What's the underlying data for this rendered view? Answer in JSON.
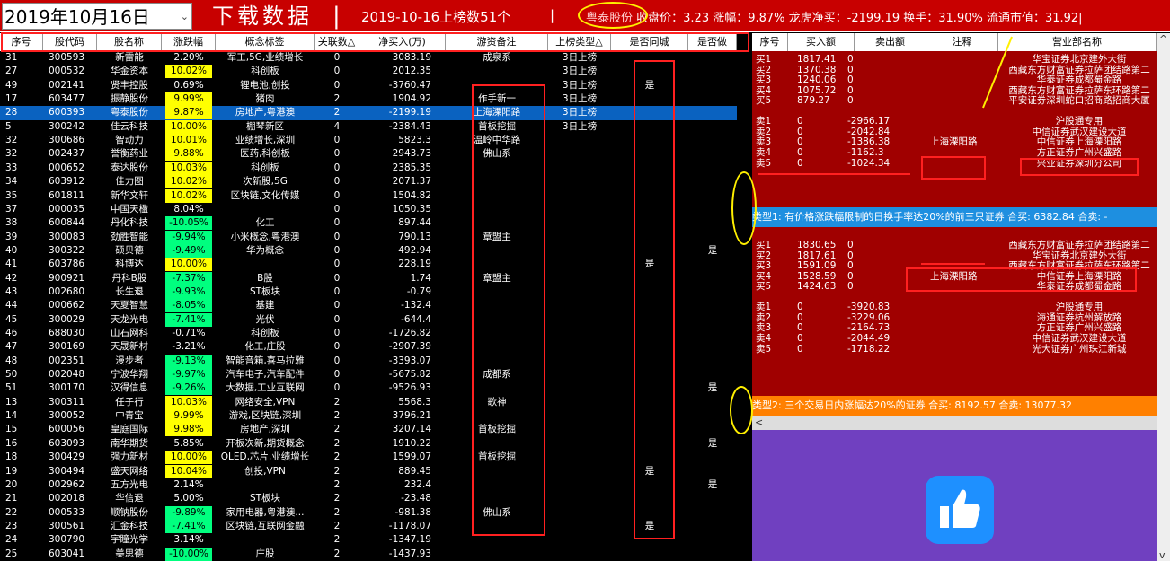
{
  "topbar": {
    "date": "2019年10月16日",
    "title": "下载数据",
    "sep": "|",
    "count": "2019-10-16上榜数51个",
    "count_sep": "|",
    "stock_name": "粤泰股份",
    "stock_detail": "收盘价：3.23 涨幅：9.87% 龙虎净买：-2199.19 换手：31.90% 流通市值：31.92|"
  },
  "left_headers": [
    "序号",
    "股代码",
    "股名称",
    "涨跌幅",
    "概念标签",
    "关联数△",
    "净买入(万)",
    "游资备注",
    "上榜类型△",
    "是否同城",
    "是否做"
  ],
  "rows": [
    [
      "31",
      "300593",
      "新雷能",
      "2.20%",
      "军工,5G,业绩增长",
      "0",
      "3083.19",
      "成泉系",
      "3日上榜",
      "",
      ""
    ],
    [
      "27",
      "000532",
      "华金资本",
      "10.02%",
      "科创板",
      "0",
      "2012.35",
      "",
      "3日上榜",
      "",
      ""
    ],
    [
      "49",
      "002141",
      "贤丰控股",
      "0.69%",
      "锂电池,创投",
      "0",
      "-3760.47",
      "",
      "3日上榜",
      "是",
      ""
    ],
    [
      "17",
      "603477",
      "振静股份",
      "9.99%",
      "猪肉",
      "2",
      "1904.92",
      "作手新一",
      "3日上榜",
      "",
      ""
    ],
    [
      "28",
      "600393",
      "粤泰股份",
      "9.87%",
      "房地产,粤港澳",
      "2",
      "-2199.19",
      "上海溧阳路",
      "3日上榜",
      "",
      ""
    ],
    [
      "5",
      "300242",
      "佳云科技",
      "10.00%",
      "棚琴新区",
      "4",
      "-2384.43",
      "首板挖掘",
      "3日上榜",
      "",
      ""
    ],
    [
      "32",
      "300686",
      "智动力",
      "10.01%",
      "业绩增长,深圳",
      "0",
      "5823.3",
      "温岭中华路",
      "",
      "",
      ""
    ],
    [
      "32",
      "002437",
      "誉衡药业",
      "9.88%",
      "医药,科创板",
      "0",
      "2943.73",
      "佛山系",
      "",
      "",
      ""
    ],
    [
      "33",
      "000652",
      "泰达股份",
      "10.03%",
      "科创板",
      "0",
      "2385.35",
      "",
      "",
      "",
      ""
    ],
    [
      "34",
      "603912",
      "佳力图",
      "10.02%",
      "次新股,5G",
      "0",
      "2071.37",
      "",
      "",
      "",
      ""
    ],
    [
      "35",
      "601811",
      "新华文轩",
      "10.02%",
      "区块链,文化传媒",
      "0",
      "1504.82",
      "",
      "",
      "",
      ""
    ],
    [
      "37",
      "000035",
      "中国天楹",
      "8.04%",
      "",
      "0",
      "1050.35",
      "",
      "",
      "",
      ""
    ],
    [
      "38",
      "600844",
      "丹化科技",
      "-10.05%",
      "化工",
      "0",
      "897.44",
      "",
      "",
      "",
      ""
    ],
    [
      "39",
      "300083",
      "劲胜智能",
      "-9.94%",
      "小米概念,粤港澳",
      "0",
      "790.13",
      "章盟主",
      "",
      "",
      ""
    ],
    [
      "40",
      "300322",
      "硕贝德",
      "-9.49%",
      "华为概念",
      "0",
      "492.94",
      "",
      "",
      "",
      "是"
    ],
    [
      "41",
      "603786",
      "科博达",
      "10.00%",
      "",
      "0",
      "228.19",
      "",
      "",
      "是",
      ""
    ],
    [
      "42",
      "900921",
      "丹科B股",
      "-7.37%",
      "B股",
      "0",
      "1.74",
      "章盟主",
      "",
      "",
      ""
    ],
    [
      "43",
      "002680",
      "长生退",
      "-9.93%",
      "ST板块",
      "0",
      "-0.79",
      "",
      "",
      "",
      ""
    ],
    [
      "44",
      "000662",
      "天夏智慧",
      "-8.05%",
      "基建",
      "0",
      "-132.4",
      "",
      "",
      "",
      ""
    ],
    [
      "45",
      "300029",
      "天龙光电",
      "-7.41%",
      "光伏",
      "0",
      "-644.4",
      "",
      "",
      "",
      ""
    ],
    [
      "46",
      "688030",
      "山石网科",
      "-0.71%",
      "科创板",
      "0",
      "-1726.82",
      "",
      "",
      "",
      ""
    ],
    [
      "47",
      "300169",
      "天晟新材",
      "-3.21%",
      "化工,庄股",
      "0",
      "-2907.39",
      "",
      "",
      "",
      ""
    ],
    [
      "48",
      "002351",
      "漫步者",
      "-9.13%",
      "智能音箱,喜马拉雅",
      "0",
      "-3393.07",
      "",
      "",
      "",
      ""
    ],
    [
      "50",
      "002048",
      "宁波华翔",
      "-9.97%",
      "汽车电子,汽车配件",
      "0",
      "-5675.82",
      "成都系",
      "",
      "",
      ""
    ],
    [
      "51",
      "300170",
      "汉得信息",
      "-9.26%",
      "大数据,工业互联网",
      "0",
      "-9526.93",
      "",
      "",
      "",
      "是"
    ],
    [
      "13",
      "300311",
      "任子行",
      "10.03%",
      "网络安全,VPN",
      "2",
      "5568.3",
      "歌神",
      "",
      "",
      ""
    ],
    [
      "14",
      "300052",
      "中青宝",
      "9.99%",
      "游戏,区块链,深圳",
      "2",
      "3796.21",
      "",
      "",
      "",
      ""
    ],
    [
      "15",
      "600056",
      "皇庭国际",
      "9.98%",
      "房地产,深圳",
      "2",
      "3207.14",
      "首板挖掘",
      "",
      "",
      ""
    ],
    [
      "16",
      "603093",
      "南华期货",
      "5.85%",
      "开板次新,期货概念",
      "2",
      "1910.22",
      "",
      "",
      "",
      "是"
    ],
    [
      "18",
      "300429",
      "强力新材",
      "10.00%",
      "OLED,芯片,业绩增长",
      "2",
      "1599.07",
      "首板挖掘",
      "",
      "",
      ""
    ],
    [
      "19",
      "300494",
      "盛天网络",
      "10.04%",
      "创投,VPN",
      "2",
      "889.45",
      "",
      "",
      "是",
      ""
    ],
    [
      "20",
      "002962",
      "五方光电",
      "2.14%",
      "",
      "2",
      "232.4",
      "",
      "",
      "",
      "是"
    ],
    [
      "21",
      "002018",
      "华信退",
      "5.00%",
      "ST板块",
      "2",
      "-23.48",
      "",
      "",
      "",
      ""
    ],
    [
      "22",
      "000533",
      "顺钠股份",
      "-9.89%",
      "家用电器,粤港澳...",
      "2",
      "-981.38",
      "佛山系",
      "",
      "",
      ""
    ],
    [
      "23",
      "300561",
      "汇金科技",
      "-7.41%",
      "区块链,互联网金融",
      "2",
      "-1178.07",
      "",
      "",
      "是",
      ""
    ],
    [
      "24",
      "300790",
      "宇瞳光学",
      "3.14%",
      "",
      "2",
      "-1347.19",
      "",
      "",
      "",
      ""
    ],
    [
      "25",
      "603041",
      "美思德",
      "-10.00%",
      "庄股",
      "2",
      "-1437.93",
      "",
      "",
      "",
      ""
    ]
  ],
  "right_headers": [
    "序号",
    "买入额",
    "卖出额",
    "注释",
    "营业部名称"
  ],
  "right_rows": [
    [
      "买1",
      "1817.41",
      "0",
      "",
      "华宝证券北京建外大街"
    ],
    [
      "买2",
      "1370.38",
      "0",
      "",
      "西藏东方财富证券拉萨团结路第二"
    ],
    [
      "买3",
      "1240.06",
      "0",
      "",
      "华泰证券成都蜀金路"
    ],
    [
      "买4",
      "1075.72",
      "0",
      "",
      "西藏东方财富证券拉萨东环路第二"
    ],
    [
      "买5",
      "879.27",
      "0",
      "",
      "平安证券深圳蛇口招商路招商大厦"
    ],
    [
      "",
      "",
      "",
      "",
      ""
    ],
    [
      "卖1",
      "0",
      "-2966.17",
      "",
      "沪股通专用"
    ],
    [
      "卖2",
      "0",
      "-2042.84",
      "",
      "中信证券武汉建设大道"
    ],
    [
      "卖3",
      "0",
      "-1386.38",
      "上海溧阳路",
      "中信证券上海溧阳路"
    ],
    [
      "卖4",
      "0",
      "-1162.3",
      "",
      "方正证券广州兴盛路"
    ],
    [
      "卖5",
      "0",
      "-1024.34",
      "",
      "兴业证券深圳分公司"
    ],
    [
      "",
      "",
      "",
      "",
      ""
    ],
    [
      "",
      "",
      "",
      "",
      ""
    ],
    [
      "买1",
      "1830.65",
      "0",
      "",
      "西藏东方财富证券拉萨团结路第二"
    ],
    [
      "买2",
      "1817.61",
      "0",
      "",
      "华宝证券北京建外大街"
    ],
    [
      "买3",
      "1591.09",
      "0",
      "",
      "西藏东方财富证券拉萨东环路第二"
    ],
    [
      "买4",
      "1528.59",
      "0",
      "上海溧阳路",
      "中信证券上海溧阳路"
    ],
    [
      "买5",
      "1424.63",
      "0",
      "",
      "华泰证券成都蜀金路"
    ],
    [
      "",
      "",
      "",
      "",
      ""
    ],
    [
      "卖1",
      "0",
      "-3920.83",
      "",
      "沪股通专用"
    ],
    [
      "卖2",
      "0",
      "-3229.06",
      "",
      "海通证券杭州解放路"
    ],
    [
      "卖3",
      "0",
      "-2164.73",
      "",
      "方正证券广州兴盛路"
    ],
    [
      "卖4",
      "0",
      "-2044.49",
      "",
      "中信证券武汉建设大道"
    ],
    [
      "卖5",
      "0",
      "-1718.22",
      "",
      "光大证券广州珠江新城"
    ]
  ],
  "banner1": "类型1: 有价格涨跌幅限制的日换手率达20%的前三只证券 合买: 6382.84 合卖: -",
  "banner2": "类型2: 三个交易日内涨幅达20%的证券 合买: 8192.57 合卖: 13077.32",
  "colors": {
    "red_bg": "#c80000",
    "dark_red": "#a00000",
    "up": "#ffff00",
    "down": "#00ff7f",
    "selected": "#0a62c0",
    "purple": "#7040c0",
    "banner1": "#1e8fe0",
    "banner2": "#ff8000"
  },
  "icons": {
    "thumb": "thumbs-up-icon",
    "dropdown": "chevron-down-icon"
  }
}
